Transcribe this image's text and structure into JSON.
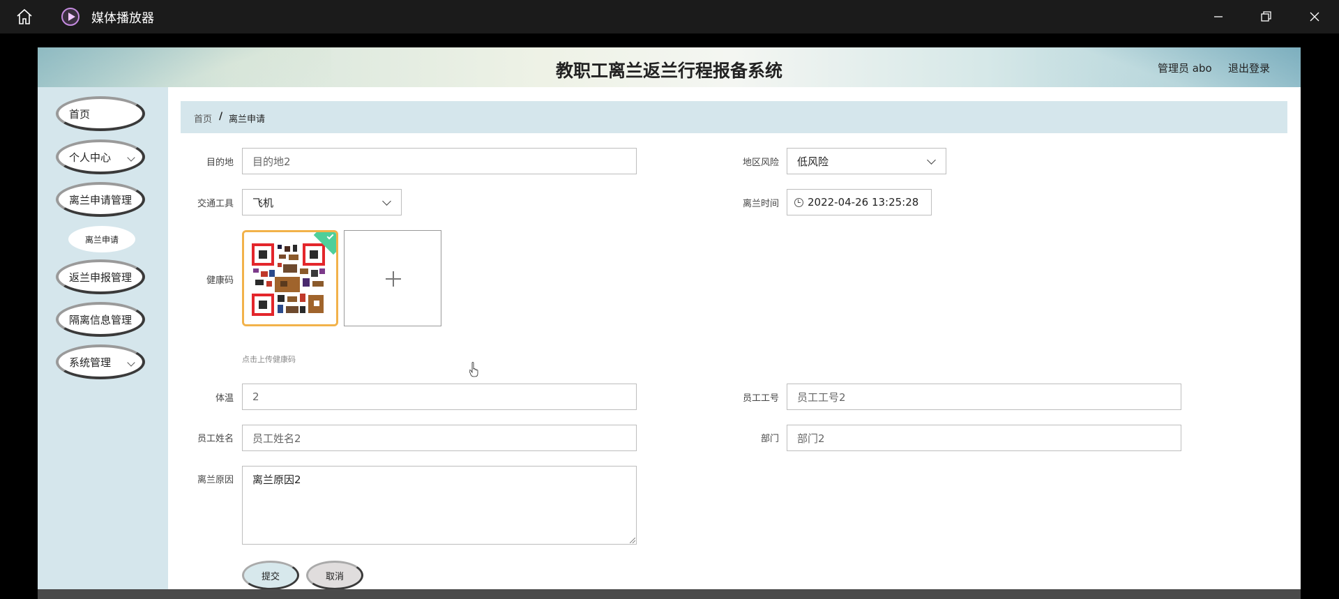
{
  "window": {
    "title": "媒体播放器",
    "icons": {
      "home": "home-icon",
      "minimize": "minimize-icon",
      "maximize": "restore-icon",
      "close": "close-icon"
    }
  },
  "header": {
    "system_title": "教职工离兰返兰行程报备系统",
    "admin_label": "管理员 abo",
    "logout_label": "退出登录"
  },
  "sidebar": {
    "items": [
      {
        "label": "首页"
      },
      {
        "label": "个人中心"
      },
      {
        "label": "离兰申请管理"
      },
      {
        "label": "离兰申请"
      },
      {
        "label": "返兰申报管理"
      },
      {
        "label": "隔离信息管理"
      },
      {
        "label": "系统管理"
      }
    ]
  },
  "breadcrumb": {
    "home": "首页",
    "separator": "/",
    "current": "离兰申请"
  },
  "form": {
    "destination": {
      "label": "目的地",
      "placeholder": "目的地2"
    },
    "risk": {
      "label": "地区风险",
      "value": "低风险"
    },
    "transport": {
      "label": "交通工具",
      "value": "飞机"
    },
    "leave_time": {
      "label": "离兰时间",
      "value": "2022-04-26 13:25:28"
    },
    "health_code": {
      "label": "健康码",
      "hint": "点击上传健康码"
    },
    "temperature": {
      "label": "体温",
      "placeholder": "2"
    },
    "employee_id": {
      "label": "员工工号",
      "placeholder": "员工工号2"
    },
    "employee_name": {
      "label": "员工姓名",
      "placeholder": "员工姓名2"
    },
    "department": {
      "label": "部门",
      "placeholder": "部门2"
    },
    "reason": {
      "label": "离兰原因",
      "value": "离兰原因2"
    },
    "submit_label": "提交",
    "cancel_label": "取消"
  },
  "colors": {
    "accent": "#d5e6ec",
    "qr_border": "#f2b24a",
    "success": "#4ecf9a"
  }
}
